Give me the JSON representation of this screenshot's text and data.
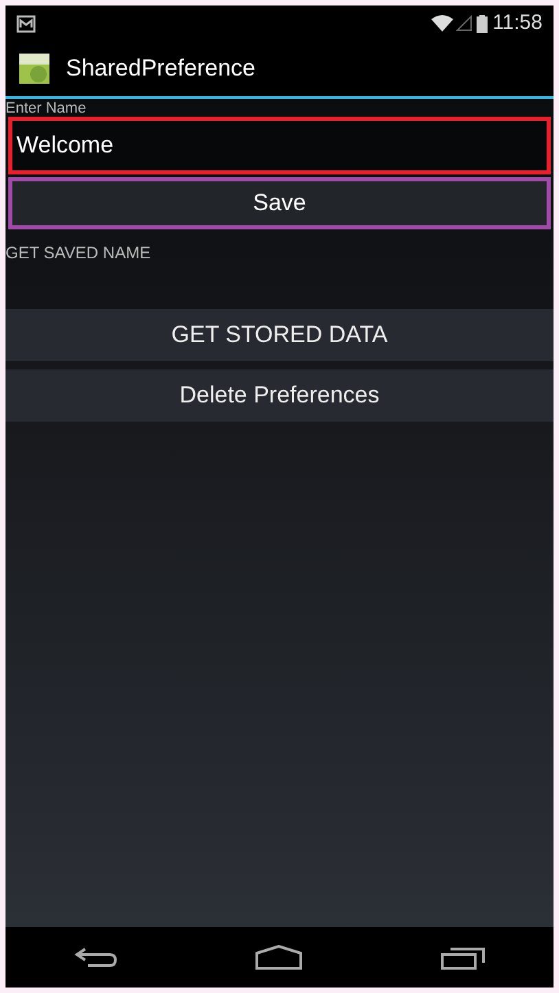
{
  "status_bar": {
    "time": "11:58"
  },
  "action_bar": {
    "title": "SharedPreference"
  },
  "name_field": {
    "label": "Enter Name",
    "value": "Welcome"
  },
  "save_button": {
    "label": "Save"
  },
  "saved_name_label": "GET SAVED NAME",
  "buttons": [
    {
      "label": "GET STORED DATA"
    },
    {
      "label": "Delete Preferences"
    }
  ]
}
